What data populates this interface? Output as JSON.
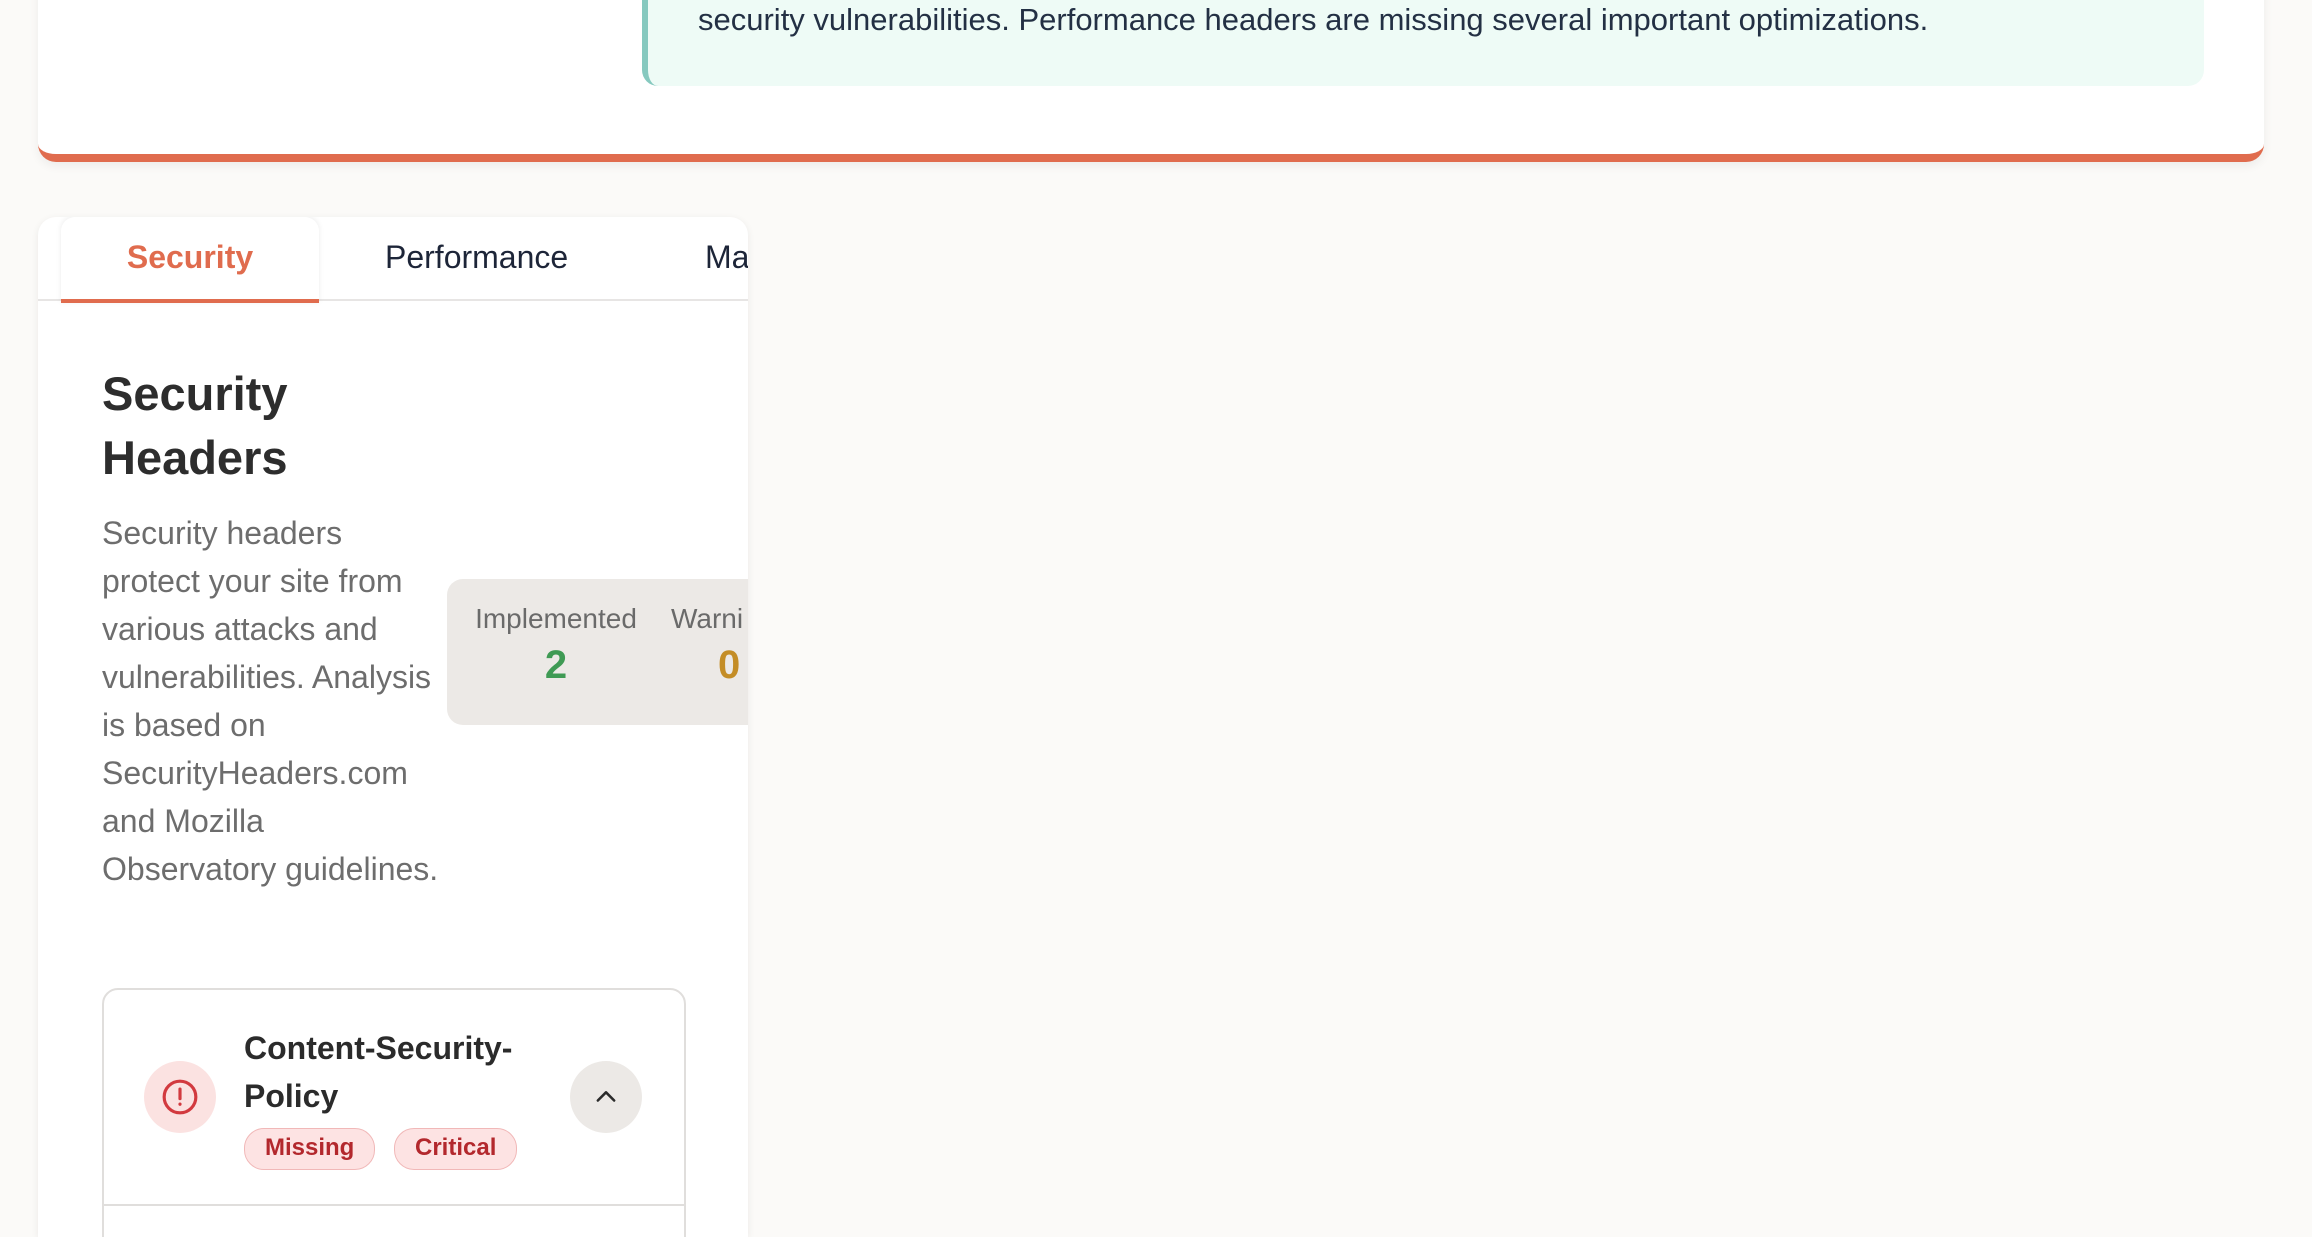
{
  "summary": {
    "text": "security vulnerabilities. Performance headers are missing several important optimizations."
  },
  "tabs": [
    {
      "label": "Security",
      "active": true
    },
    {
      "label": "Performance",
      "active": false
    },
    {
      "label": "Ma",
      "active": false
    }
  ],
  "section": {
    "title": "Security Headers",
    "description": "Security headers protect your site from various attacks and vulnerabilities. Analysis is based on SecurityHeaders.com and Mozilla Observatory guidelines."
  },
  "stats": {
    "implemented": {
      "label": "Implemented",
      "value": "2",
      "color": "#3f9a54"
    },
    "warnings": {
      "label": "Warni",
      "value": "0",
      "color": "#c48d26"
    }
  },
  "headers": [
    {
      "name": "Content-Security-Policy",
      "status_badge": "Missing",
      "severity_badge": "Critical",
      "icon": "alert-circle-icon",
      "expand_icon": "chevron-up-icon"
    }
  ],
  "colors": {
    "accent": "#e06c4e",
    "danger": "#b3282d",
    "summary_bg": "#eefbf6"
  }
}
